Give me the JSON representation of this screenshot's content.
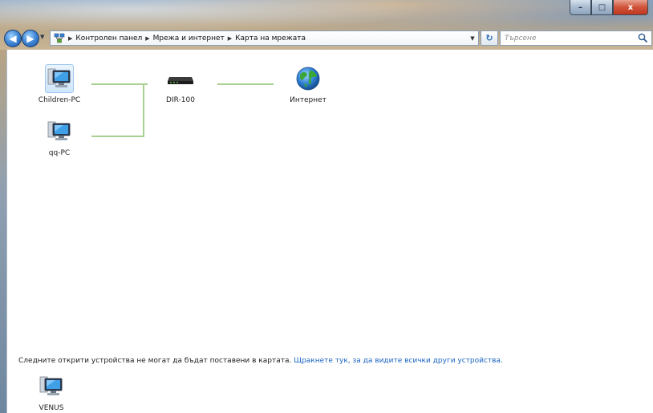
{
  "window": {
    "caption": {
      "minimize": "–",
      "maximize": "□",
      "close": "x"
    }
  },
  "nav": {
    "back_icon": "back-arrow-icon",
    "forward_icon": "forward-arrow-icon",
    "breadcrumbs": [
      "Контролен панел",
      "Мрежа и интернет",
      "Карта на мрежата"
    ],
    "search_placeholder": "Търсене",
    "refresh_icon": "refresh-icon"
  },
  "map": {
    "nodes": [
      {
        "id": "children-pc",
        "label": "Children-PC",
        "icon": "computer-icon",
        "selected": true
      },
      {
        "id": "qq-pc",
        "label": "qq-PC",
        "icon": "computer-icon",
        "selected": false
      },
      {
        "id": "router",
        "label": "DIR-100",
        "icon": "router-icon",
        "selected": false
      },
      {
        "id": "internet",
        "label": "Интернет",
        "icon": "globe-icon",
        "selected": false
      }
    ],
    "connection_color": "#a9cf93"
  },
  "unplaced": {
    "message": "Следните открити устройства не могат да бъдат поставени в картата.",
    "link": "Щракнете тук, за да видите всички други устройства.",
    "devices": [
      {
        "label": "VENUS",
        "icon": "computer-icon"
      }
    ]
  },
  "colors": {
    "link": "#1a64c0",
    "accent": "#3f86d6"
  }
}
